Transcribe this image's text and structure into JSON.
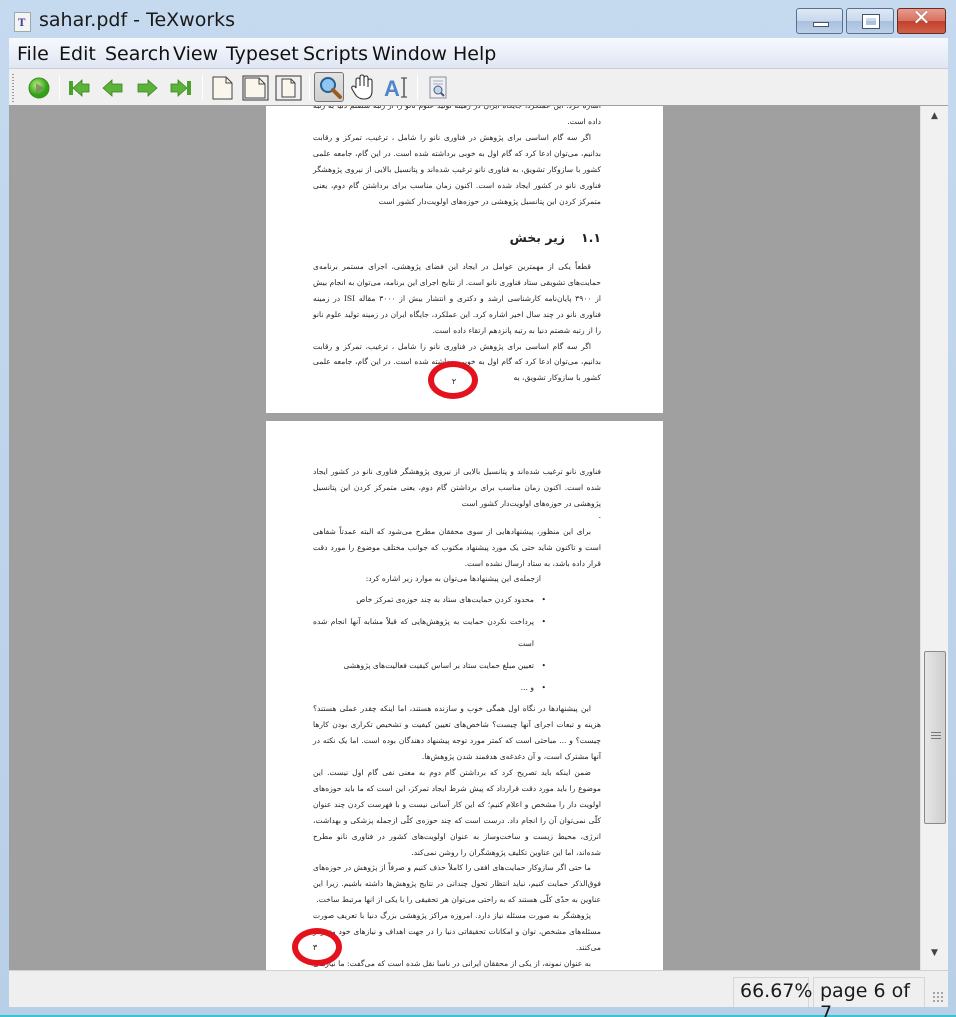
{
  "window": {
    "title": "sahar.pdf - TeXworks",
    "controls": {
      "minimize": "—",
      "maximize": "□",
      "close": "✕"
    }
  },
  "menubar": {
    "items": [
      {
        "label": "File"
      },
      {
        "label": "Edit"
      },
      {
        "label": "Search"
      },
      {
        "label": "View"
      },
      {
        "label": "Typeset"
      },
      {
        "label": "Scripts"
      },
      {
        "label": "Window"
      },
      {
        "label": "Help"
      }
    ]
  },
  "toolbar": {
    "buttons": [
      {
        "name": "typeset",
        "icon": "play-icon"
      },
      {
        "name": "first-page",
        "icon": "first-page-icon"
      },
      {
        "name": "previous-page",
        "icon": "arrow-left-icon"
      },
      {
        "name": "next-page",
        "icon": "arrow-right-icon"
      },
      {
        "name": "last-page",
        "icon": "last-page-icon"
      },
      {
        "name": "actual-size",
        "icon": "page-icon"
      },
      {
        "name": "fit-width",
        "icon": "page-fit-width-icon"
      },
      {
        "name": "fit-window",
        "icon": "page-fit-window-icon"
      },
      {
        "name": "magnify-tool",
        "icon": "magnifier-icon",
        "active": true
      },
      {
        "name": "scroll-tool",
        "icon": "hand-icon"
      },
      {
        "name": "select-text-tool",
        "icon": "text-select-icon"
      },
      {
        "name": "go-to-source",
        "icon": "document-search-icon"
      }
    ]
  },
  "document": {
    "page2": {
      "top_partial_line": "اشاره کرد. این عملکرد، جایگاه ایران در زمینه تولید علوم نانو را از رتبه شصتم دنیا به رتبه پانزدهم ارتقاء",
      "lines_top": [
        "داده است.",
        "اگر سه گام اساسی برای پژوهش در فناوری نانو را شامل ، ترغیب، تمرکز و رقابت بدانیم، می‌توان ادعا کرد که گام اول به خوبی برداشته شده است. در این گام، جامعه علمی کشور با سازوکار تشویق، به فناوری نانو ترغیب شده‌اند و پتانسیل بالایی از نیروی پژوهشگر فناوری نانو در کشور ایجاد شده است. اکنون زمان مناسب برای برداشتن گام دوم، یعنی متمرکز کردن این پتانسیل پژوهشی در حوزه‌های اولویت‌دار کشور است"
      ],
      "section": {
        "number": "۱.۱",
        "title": "زیر بخش"
      },
      "paragraph1": "قطعاً یکی از مهمترین عوامل در ایجاد این فضای پژوهشی، اجرای مستمر برنامه‌ی حمایت‌های تشویقی ستاد فناوری نانو است. از نتایج اجرای این برنامه، می‌توان به انجام بیش از ۳۹۰۰ پایان‌نامه کارشناسی ارشد و دکتری و انتشار بیش از ۳۰۰۰ مقاله ISI در زمینه فناوری نانو در چند سال اخیر اشاره کرد. این عملکرد، جایگاه ایران در زمینه تولید علوم نانو را از رتبه شصتم دنیا به رتبه پانزدهم ارتقاء داده است.",
      "paragraph2": "اگر سه گام اساسی برای پژوهش در فناوری نانو را شامل ، ترغیب، تمرکز و رقابت بدانیم، می‌توان ادعا کرد که گام اول به خوبی برداشته شده است. در این گام، جامعه علمی کشور با سازوکار تشویق، به",
      "page_number": "۲"
    },
    "page3": {
      "paragraph1": "فناوری نانو ترغیب شده‌اند و پتانسیل بالایی از نیروی پژوهشگر فناوری نانو در کشور ایجاد شده است. اکنون زمان مناسب برای برداشتن گام دوم، یعنی متمرکز کردن این پتانسیل پژوهشی در حوزه‌های اولویت‌دار کشور است",
      "dot": ".",
      "paragraph2": "برای این منظور، پیشنهادهایی از سوی محققان مطرح می‌شود که البته عمدتاً شفاهی است و تاکنون شاید حتی یک مورد پیشنهاد مکتوب که جوانب مختلف موضوع را مورد دقت قرار داده باشد، به ستاد ارسال نشده است.",
      "list_intro": "ازجمله‌ی این پیشنهادها می‌توان به موارد زیر اشاره کرد:",
      "bullets": [
        "محدود کردن حمایت‌های ستاد به چند حوزه‌ی تمرکز خاص",
        "پرداخت نکردن حمایت به پژوهش‌هایی که قبلاً مشابه آنها انجام شده است",
        "تعیین مبلغ حمایت ستاد بر اساس کیفیت فعالیت‌های پژوهشی",
        "و ..."
      ],
      "paragraph3": "این پیشنهادها در نگاه اول همگی خوب و سازنده هستند، اما اینکه چقدر عملی هستند؟ هزینه و تبعات اجرای آنها چیست؟ شاخص‌های تعیین کیفیت و تشخیص تکراری بودن کارها چیست؟ و ... مباحثی است که کمتر مورد توجه پیشنهاد دهندگان بوده است. اما یک نکته در آنها مشترک است، و آن دغدغه‌ی هدفمند شدن پژوهش‌ها.",
      "paragraph4": "ضمن اینکه باید تصریح کرد که برداشتن گام دوم به معنی نفی گام اول نیست. این موضوع را باید مورد دقت قرارداد که پیش شرط ایجاد تمرکز، این است که ما باید حوزه‌های اولویت دار را مشخص و اعلام کنیم؛ که این کار آسانی نیست و با فهرست کردن چند عنوان کلّی نمی‌توان آن را انجام داد. درست است که چند حوزه‌ی کلّی ازجمله پزشکی و بهداشت، انرژی، محیط زیست و ساخت‌وساز به عنوان اولویت‌های کشور در فناوری نانو مطرح شده‌اند، اما این عناوین تکلیف پژوهشگران را روشن نمی‌کند.",
      "paragraph5": "ما حتی اگر سازوکار حمایت‌های افقی را کاملاً حذف کنیم و صرفاً از پژوهش در حوزه‌های فوق‌الذکر حمایت کنیم، نباید انتظار تحول چندانی در نتایج پژوهش‌ها داشته باشیم. زیرا این عناوین به حدّی کلّی هستند که به راحتی می‌توان هر تحقیقی را با یکی از انها مرتبط ساخت.",
      "paragraph6": "پژوهشگر به صورت مسئله نیاز دارد. امروزه مراکز پژوهشی بزرگ دنیا با تعریف صورت مسئله‌های مشخص، توان و امکانات تحقیقاتی دنیا را در جهت اهداف و نیازهای خود متمرکز می‌کنند.",
      "paragraph7": "به عنوان نمونه، از یکی از محققان ایرانی در ناسا نقل شده است که می‌گفت: ما نیازهای پژوهشی خودمان را – مثلا در زمینه‌ی مخابرات– در قالب صورت مسئله‌های مشخص، به عنوان مرزهای تحقیقات",
      "page_number": "۳"
    }
  },
  "statusbar": {
    "zoom": "66.67%",
    "page_indicator": "page 6 of 7",
    "current_page": 6,
    "total_pages": 7
  },
  "scrollbar": {
    "position_fraction": 0.84
  },
  "colors": {
    "annotation_circle": "#e3121c",
    "viewport_bg": "#a0a0a0",
    "close_button": "#c2412b"
  }
}
